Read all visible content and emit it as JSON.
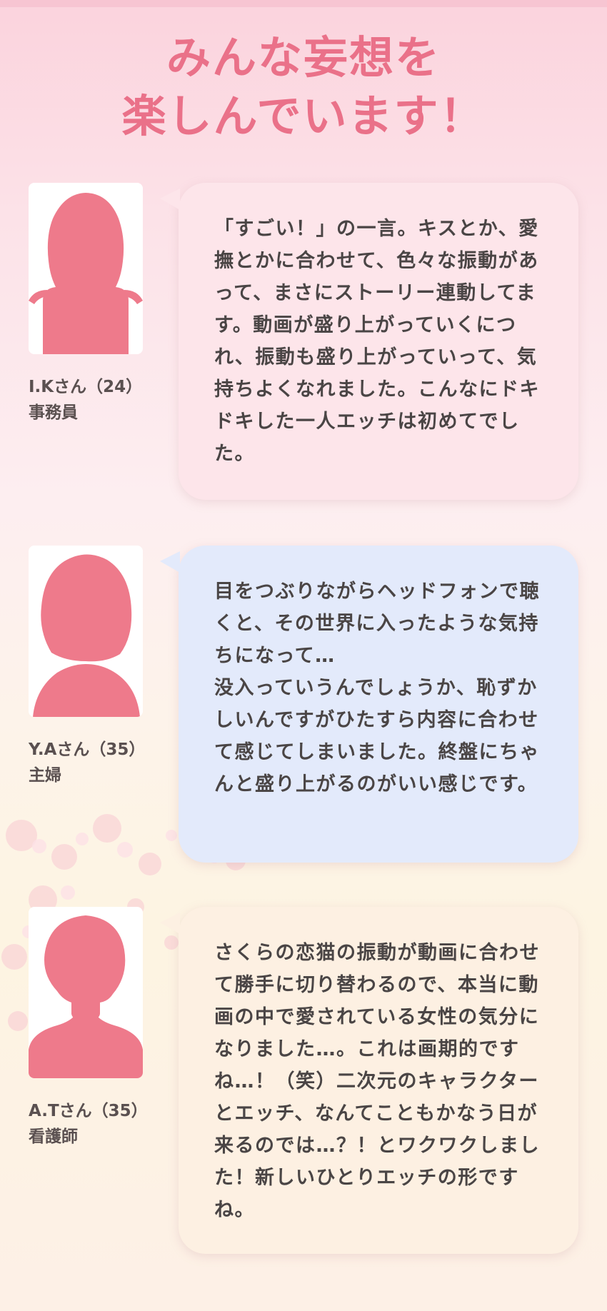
{
  "title": {
    "line1": "みんな妄想を",
    "line2": "楽しんでいます！"
  },
  "colors": {
    "accent": "#ea7189",
    "silhouette": "#ee7a8b",
    "text": "#4a4545",
    "bubble_pink": "#fde5ea",
    "bubble_blue": "#e3eafb",
    "bubble_cream": "#fdf0e2"
  },
  "reviews": [
    {
      "name": "I.Kさん（24）",
      "occupation": "事務員",
      "avatar_icon": "woman-silhouette-icon",
      "comment": "「すごい！」の一言。キスとか、愛撫とかに合わせて、色々な振動があって、まさにストーリー連動してます。動画が盛り上がっていくにつれ、振動も盛り上がっていって、気持ちよくなれました。こんなにドキドキした一人エッチは初めてでした。"
    },
    {
      "name": "Y.Aさん（35）",
      "occupation": "主婦",
      "avatar_icon": "woman-silhouette-icon",
      "comment": "目をつぶりながらヘッドフォンで聴くと、その世界に入ったような気持ちになって…\n没入っていうんでしょうか、恥ずかしいんですがひたすら内容に合わせて感じてしまいました。終盤にちゃんと盛り上がるのがいい感じです。"
    },
    {
      "name": "A.Tさん（35）",
      "occupation": "看護師",
      "avatar_icon": "woman-silhouette-icon",
      "comment": "さくらの恋猫の振動が動画に合わせて勝手に切り替わるので、本当に動画の中で愛されている女性の気分になりました…。これは画期的ですね…！（笑）二次元のキャラクターとエッチ、なんてこともかなう日が来るのでは…？！とワクワクしました！新しいひとりエッチの形ですね。"
    }
  ]
}
